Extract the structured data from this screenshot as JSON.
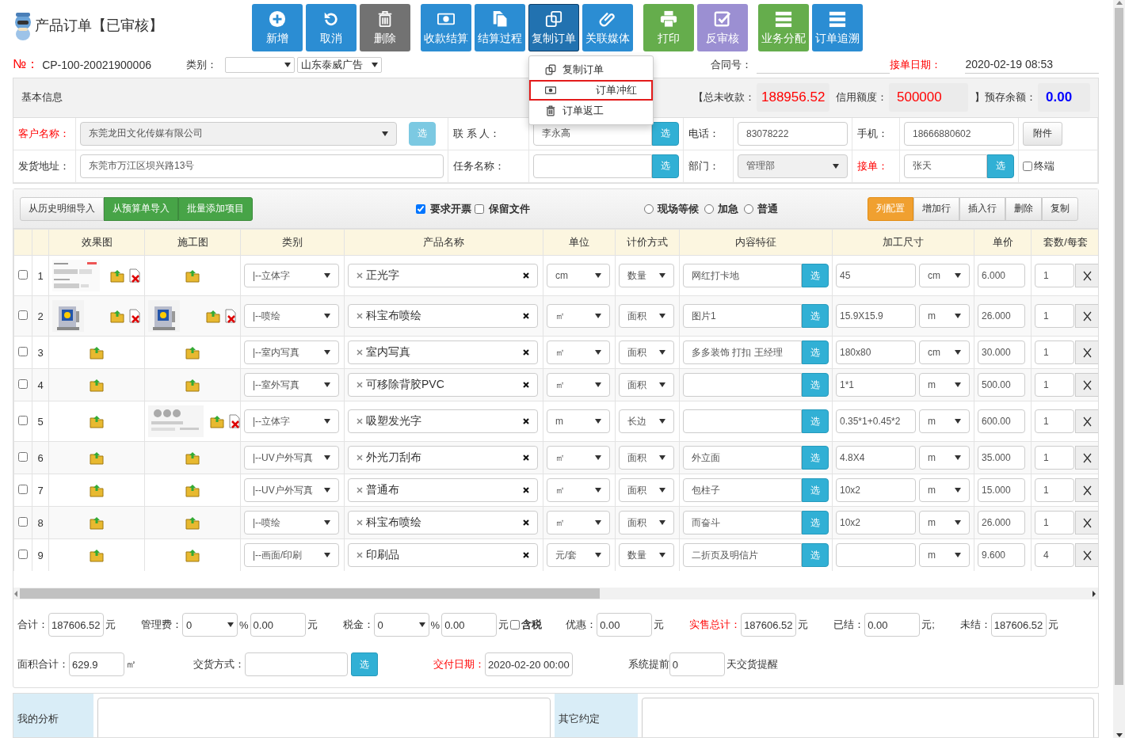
{
  "header": {
    "title": "产品订单【已审核】"
  },
  "toolbar_groups": [
    [
      {
        "label": "新增",
        "color": "#2b8dd3",
        "active": false
      },
      {
        "label": "取消",
        "color": "#2b8dd3",
        "active": false
      },
      {
        "label": "删除",
        "color": "#727272",
        "active": false
      }
    ],
    [
      {
        "label": "收款结算",
        "color": "#2b8dd3",
        "active": false
      },
      {
        "label": "结算过程",
        "color": "#2b8dd3",
        "active": false
      },
      {
        "label": "复制订单",
        "color": "#2272b0",
        "active": true
      },
      {
        "label": "关联媒体",
        "color": "#2b8dd3",
        "active": false
      }
    ],
    [
      {
        "label": "打印",
        "color": "#65ad4c",
        "active": false
      },
      {
        "label": "反审核",
        "color": "#9b8fd2",
        "active": false
      }
    ],
    [
      {
        "label": "业务分配",
        "color": "#65ad4c",
        "active": false
      },
      {
        "label": "订单追溯",
        "color": "#2b8dd3",
        "active": false
      }
    ]
  ],
  "menu": [
    {
      "label": "复制订单",
      "selected": false
    },
    {
      "label": "订单冲红",
      "selected": true
    },
    {
      "label": "订单返工",
      "selected": false
    }
  ],
  "order_bar": {
    "no_label": "№：",
    "no": "CP-100-20021900006",
    "category_label": "类别：",
    "company": "山东泰威广告",
    "contract_label": "合同号：",
    "date_label": "接单日期：",
    "date": "2020-02-19 08:53"
  },
  "basic_info": {
    "title": "基本信息",
    "unpaid_label": "【总未收款：",
    "unpaid": "188956.52",
    "credit_label": "信用额度：",
    "credit": "500000",
    "prestore_label": "】预存余额：",
    "prestore": "0.00",
    "rows": [
      [
        {
          "kind": "select",
          "label": "客户名称：",
          "emphasis": true,
          "value": "东莞龙田文化传媒有限公司",
          "pick": "选",
          "pick_enabled": false
        },
        {
          "kind": "input",
          "label": "联 系 人：",
          "emphasis": false,
          "value": "李永高",
          "pick": "选",
          "pick_enabled": true
        },
        {
          "kind": "input",
          "label": "电话：",
          "emphasis": false,
          "value": "83078222"
        },
        {
          "kind": "input",
          "label": "手机：",
          "emphasis": false,
          "value": "18666880602"
        },
        {
          "kind": "button",
          "text": "附件"
        }
      ],
      [
        {
          "kind": "input",
          "label": "发货地址：",
          "emphasis": false,
          "value": "东莞市万江区坝兴路13号"
        },
        {
          "kind": "input",
          "label": "任务名称：",
          "emphasis": false,
          "pick": "选",
          "pick_enabled": true
        },
        {
          "kind": "select",
          "label": "部门：",
          "emphasis": false,
          "value": "管理部"
        },
        {
          "kind": "input",
          "label": "接单：",
          "emphasis": true,
          "value": "张天",
          "pick": "选",
          "pick_enabled": true
        },
        {
          "kind": "checkbox",
          "text": "终端",
          "checked": false
        }
      ]
    ]
  },
  "items": {
    "import_buttons": [
      {
        "label": "从历史明细导入",
        "kind": "default"
      },
      {
        "label": "从预算单导入",
        "kind": "success"
      },
      {
        "label": "批量添加项目",
        "kind": "success"
      }
    ],
    "options": [
      {
        "label": "要求开票",
        "checked": true
      },
      {
        "label": "保留文件",
        "checked": false
      }
    ],
    "priority": [
      {
        "label": "现场等候",
        "selected": false
      },
      {
        "label": "加急",
        "selected": false
      },
      {
        "label": "普通",
        "selected": false
      }
    ],
    "actions": [
      {
        "label": "列配置",
        "kind": "warning"
      },
      {
        "label": "增加行",
        "kind": "default"
      },
      {
        "label": "插入行",
        "kind": "default"
      },
      {
        "label": "删除",
        "kind": "default"
      },
      {
        "label": "复制",
        "kind": "default"
      }
    ],
    "columns": [
      "效果图",
      "施工图",
      "类别",
      "产品名称",
      "单位",
      "计价方式",
      "内容特征",
      "加工尺寸",
      "单价",
      "套数/每套"
    ],
    "rows": [
      {
        "no": "1",
        "checked": false,
        "effect_image": true,
        "construction_image": false,
        "category": "|--立体字",
        "product": "正光字",
        "unit": "cm",
        "pricing": "数量",
        "content": "网红打卡地",
        "pick": "选",
        "size": "45",
        "size_unit": "cm",
        "price": "6.000",
        "qty": "1"
      },
      {
        "no": "2",
        "checked": false,
        "effect_image": true,
        "construction_image": true,
        "category": "|--喷绘",
        "product": "科宝布喷绘",
        "unit": "㎡",
        "pricing": "面积",
        "content": "图片1",
        "pick": "选",
        "size": "15.9X15.9",
        "size_unit": "m",
        "price": "26.000",
        "qty": "1"
      },
      {
        "no": "3",
        "checked": false,
        "effect_image": false,
        "construction_image": false,
        "category": "|--室内写真",
        "product": "室内写真",
        "unit": "㎡",
        "pricing": "面积",
        "content": "多多装饰 打扣 王经理",
        "pick": "选",
        "size": "180x80",
        "size_unit": "cm",
        "price": "30.000",
        "qty": "1"
      },
      {
        "no": "4",
        "checked": false,
        "effect_image": false,
        "construction_image": false,
        "category": "|--室外写真",
        "product": "可移除背胶PVC",
        "unit": "㎡",
        "pricing": "面积",
        "pick": "选",
        "size": "1*1",
        "size_unit": "m",
        "price": "500.00",
        "qty": "1"
      },
      {
        "no": "5",
        "checked": false,
        "effect_image": false,
        "construction_image": true,
        "category": "|--立体字",
        "product": "吸塑发光字",
        "unit": "m",
        "pricing": "长边",
        "pick": "选",
        "size": "0.35*1+0.45*2",
        "size_unit": "m",
        "price": "600.00",
        "qty": "1"
      },
      {
        "no": "6",
        "checked": false,
        "effect_image": false,
        "construction_image": false,
        "category": "|--UV户外写真",
        "product": "外光刀刮布",
        "unit": "㎡",
        "pricing": "面积",
        "content": "外立面",
        "pick": "选",
        "size": "4.8X4",
        "size_unit": "m",
        "price": "35.000",
        "qty": "1"
      },
      {
        "no": "7",
        "checked": false,
        "effect_image": false,
        "construction_image": false,
        "category": "|--UV户外写真",
        "product": "普通布",
        "unit": "㎡",
        "pricing": "面积",
        "content": "包柱子",
        "pick": "选",
        "size": "10x2",
        "size_unit": "m",
        "price": "15.000",
        "qty": "1"
      },
      {
        "no": "8",
        "checked": false,
        "effect_image": false,
        "construction_image": false,
        "category": "|--喷绘",
        "product": "科宝布喷绘",
        "unit": "㎡",
        "pricing": "面积",
        "content": "而奋斗",
        "pick": "选",
        "size": "10x2",
        "size_unit": "m",
        "price": "26.000",
        "qty": "1"
      },
      {
        "no": "9",
        "checked": false,
        "effect_image": false,
        "construction_image": false,
        "category": "|--画面/印刷",
        "product": "印刷品",
        "unit": "元/套",
        "pricing": "数量",
        "content": "二折页及明信片",
        "pick": "选",
        "size_unit": "m",
        "price": "9.600",
        "qty": "4"
      }
    ]
  },
  "totals": [
    {
      "fields": [
        {
          "kind": "input",
          "label": "合计：",
          "emphasis": false,
          "value": "187606.52",
          "unit": "元"
        },
        {
          "kind": "rate",
          "label": "管理费：",
          "emphasis": false,
          "rate": "0",
          "percent": "%",
          "value": "0.00",
          "unit": "元"
        },
        {
          "kind": "rate",
          "label": "税金：",
          "emphasis": false,
          "rate": "0",
          "percent": "%",
          "value": "0.00",
          "unit": "元",
          "checkbox": "含税",
          "checked": false
        },
        {
          "kind": "input",
          "label": "优惠：",
          "emphasis": false,
          "value": "0.00",
          "unit": "元"
        },
        {
          "kind": "input",
          "label": "实售总计：",
          "emphasis": true,
          "value": "187606.52",
          "unit": "元"
        },
        {
          "kind": "input",
          "label": "已结：",
          "emphasis": false,
          "value": "0.00",
          "unit": "元;"
        },
        {
          "kind": "input",
          "label": "未结：",
          "emphasis": false,
          "value": "187606.52",
          "unit": "元"
        }
      ]
    },
    {
      "fields": [
        {
          "kind": "input",
          "label": "面积合计：",
          "emphasis": false,
          "value": "629.9",
          "unit": "㎡"
        },
        {
          "kind": "pick",
          "label": "交货方式：",
          "emphasis": false,
          "pick": "选"
        },
        {
          "kind": "input",
          "label": "交付日期：",
          "emphasis": true,
          "value": "2020-02-20 00:00"
        },
        {
          "kind": "input",
          "label": "系统提前",
          "emphasis": false,
          "value": "0",
          "unit": "天交货提醒"
        }
      ]
    }
  ],
  "notes": [
    {
      "label": "我的分析"
    },
    {
      "label": "其它约定"
    }
  ]
}
